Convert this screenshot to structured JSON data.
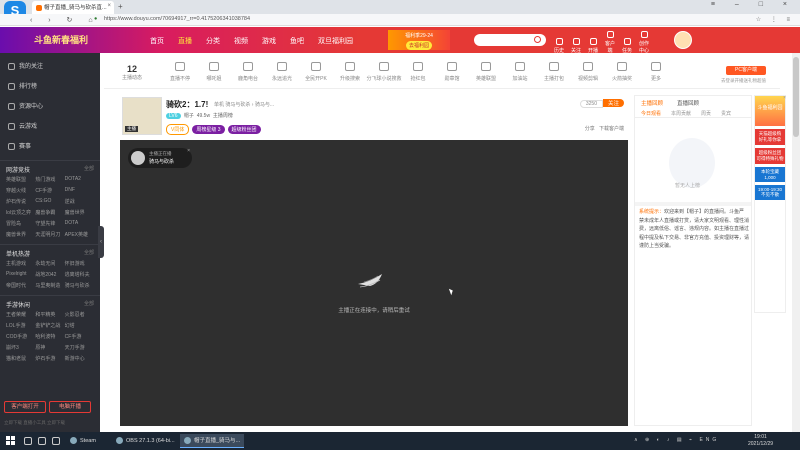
{
  "browser": {
    "tab_title": "帽子直播_骑马与砍杀直...",
    "url": "https://www.douyu.com/70694917_rr=0.4175206341038784"
  },
  "header": {
    "brand": "斗鱼新春福利",
    "nav": [
      "首页",
      "直播",
      "分类",
      "视频",
      "游戏",
      "鱼吧",
      "双旦福利园"
    ],
    "promo_line": "福利季29-24",
    "promo_button": "去福利园",
    "icons": [
      {
        "name": "history-icon",
        "label": "历史"
      },
      {
        "name": "follow-icon",
        "label": "关注"
      },
      {
        "name": "broadcast-icon",
        "label": "开播"
      },
      {
        "name": "client-icon",
        "label": "客户端"
      },
      {
        "name": "task-icon",
        "label": "任务"
      },
      {
        "name": "creator-icon",
        "label": "创作中心"
      }
    ]
  },
  "sidebar": {
    "main": [
      {
        "icon": "star-icon",
        "label": "我的关注"
      },
      {
        "icon": "rank-icon",
        "label": "排行榜"
      },
      {
        "icon": "resource-icon",
        "label": "资源中心"
      },
      {
        "icon": "cloud-game-icon",
        "label": "云游戏"
      },
      {
        "icon": "event-icon",
        "label": "赛事"
      }
    ],
    "sections": [
      {
        "title": "网游竞技",
        "more": "全部",
        "items": [
          "英雄联盟",
          "热门游戏",
          "DOTA2",
          "穿越火线",
          "CF手游",
          "DNF",
          "炉石传说",
          "CS:GO",
          "逆战",
          "lol云顶之弈",
          "魔兽争霸",
          "魔兽世界",
          "冒险岛",
          "守望先锋",
          "DOTA",
          "魔兽世界",
          "天涯明月刀",
          "APEX英雄"
        ]
      },
      {
        "title": "单机热游",
        "more": "全部",
        "items": [
          "主机游戏",
          "永劫无间",
          "怀旧游戏",
          "Pixelright",
          "战地2042",
          "逃离塔科夫",
          "帝国时代",
          "马里奥制造",
          "骑马与砍杀"
        ]
      },
      {
        "title": "手游休闲",
        "more": "全部",
        "items": [
          "王者荣耀",
          "和平精英",
          "火影忍者",
          "LOL手游",
          "金铲铲之战",
          "幻塔",
          "COD手游",
          "哈利波特",
          "CF手游",
          "崩坏3",
          "原神",
          "天刀手游",
          "猫和老鼠",
          "炉石手游",
          "新游中心"
        ]
      }
    ],
    "buttons": [
      "客户端打开",
      "电脑开播"
    ],
    "footer": "立即下载 直播小工具 立即下载"
  },
  "categories": {
    "count": "12",
    "count_label": "主播动态",
    "items": [
      "直播不停",
      "哪吒姐",
      "鹿角电台",
      "永远追光",
      "全民开PK",
      "升级搜索",
      "分飞球小说搜救",
      "抢红包",
      "勋章馆",
      "英雄联盟",
      "加油站",
      "主播打包",
      "视频剪辑",
      "火箭抽奖",
      "更多"
    ],
    "pc_button": "PC客户端",
    "pc_sub": "去登录开播送礼物超值"
  },
  "room": {
    "title": "骑砍2：1.7!",
    "meta": "单机  骑马与砍杀 › 骑马与...",
    "level": "LV6",
    "anchor_name": "帽子",
    "heat": "49.5w",
    "report": "主播周榜",
    "badges": [
      "V同体",
      "周榜星级  3",
      "超级粉丝团"
    ],
    "follow_count": "3250",
    "follow_label": "关注",
    "share": "分享",
    "download": "下载客户端",
    "avatar_tag": "主播"
  },
  "player": {
    "anchor_line1": "主播正在播",
    "anchor_line2": "骑马与砍杀",
    "message": "主播正在连接中，请稍后重试"
  },
  "chat": {
    "tabs": [
      "主播回顾",
      "直播回顾"
    ],
    "subtabs": [
      "今日观看",
      "本周贡献",
      "周贡",
      "贵宾"
    ],
    "empty": "暂无人上榜",
    "sys_label": "系统提示：",
    "sys_text": "欢迎来到【帽子】的直播间。斗鱼严禁未成年人直播或打赏，请大家文明观看、理性消费，远离低俗、谣言、违规内容。如主播在直播过程中提及私下交易、非官方充值、投资理财等，请谨防上当受骗。"
  },
  "floatad": {
    "top": "斗鱼福利园",
    "items": [
      "天猫超级购 好礼等你拿",
      "超级粉丝团 可得特殊礼物",
      "本轮宝藏 1,000",
      "19:00-19:30 不见不散"
    ]
  },
  "taskbar": {
    "apps": [
      "Steam",
      "OBS 27.1.3 (64-bi...",
      "帽子直播_骑马与..."
    ],
    "tray": "∧ ⊕ ◐ ♪ ▤ ⌁ ENG",
    "time": "19:01",
    "date": "2021/12/29"
  }
}
